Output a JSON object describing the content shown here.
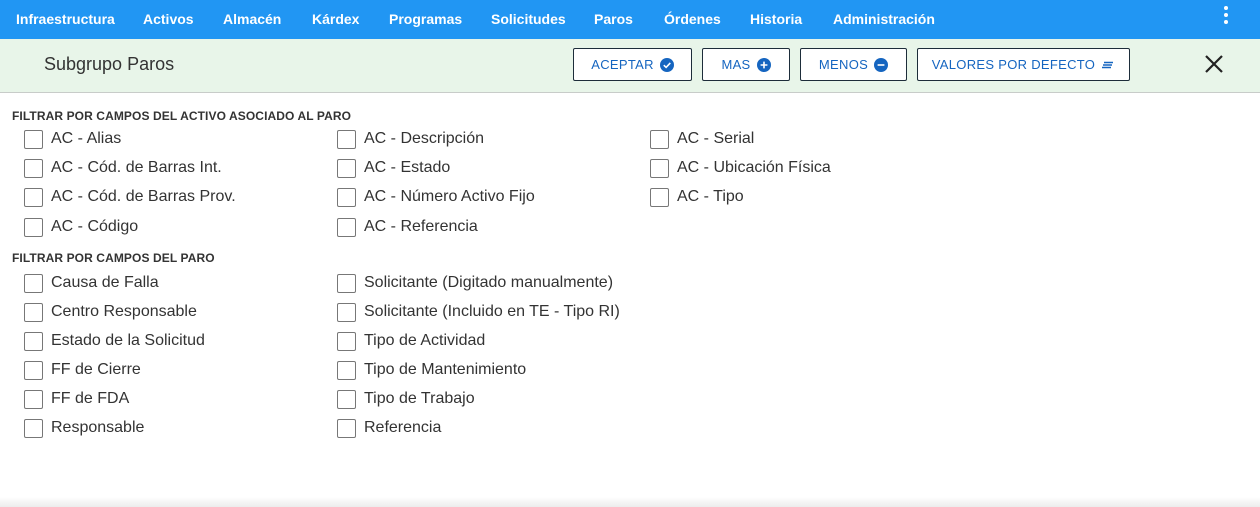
{
  "nav": {
    "items": [
      "Infraestructura",
      "Activos",
      "Almacén",
      "Kárdex",
      "Programas",
      "Solicitudes",
      "Paros",
      "Órdenes",
      "Historia",
      "Administración"
    ],
    "more_icon": "kebab-menu-icon"
  },
  "header": {
    "title": "Subgrupo Paros",
    "buttons": {
      "accept": "ACEPTAR",
      "more": "MAS",
      "less": "MENOS",
      "defaults": "VALORES POR DEFECTO"
    },
    "close_icon": "close-icon"
  },
  "colors": {
    "accent": "#2196f3",
    "header_bg": "#e8f5e9",
    "button_text": "#1565c0"
  },
  "sections": {
    "asset": {
      "title": "FILTRAR POR CAMPOS DEL ACTIVO ASOCIADO AL PARO",
      "col1": [
        "AC - Alias",
        "AC - Cód. de Barras Int.",
        "AC - Cód. de Barras Prov.",
        "AC - Código"
      ],
      "col2": [
        "AC - Descripción",
        "AC - Estado",
        "AC - Número Activo Fijo",
        "AC - Referencia"
      ],
      "col3": [
        "AC - Serial",
        "AC - Ubicación Física",
        "AC - Tipo"
      ]
    },
    "stop": {
      "title": "FILTRAR POR CAMPOS DEL PARO",
      "col1": [
        "Causa de Falla",
        "Centro Responsable",
        "Estado de la Solicitud",
        "FF de Cierre",
        "FF de FDA",
        "Responsable"
      ],
      "col2": [
        "Solicitante (Digitado manualmente)",
        "Solicitante (Incluido en TE - Tipo RI)",
        "Tipo de Actividad",
        "Tipo de Mantenimiento",
        "Tipo de Trabajo",
        "Referencia"
      ]
    }
  }
}
